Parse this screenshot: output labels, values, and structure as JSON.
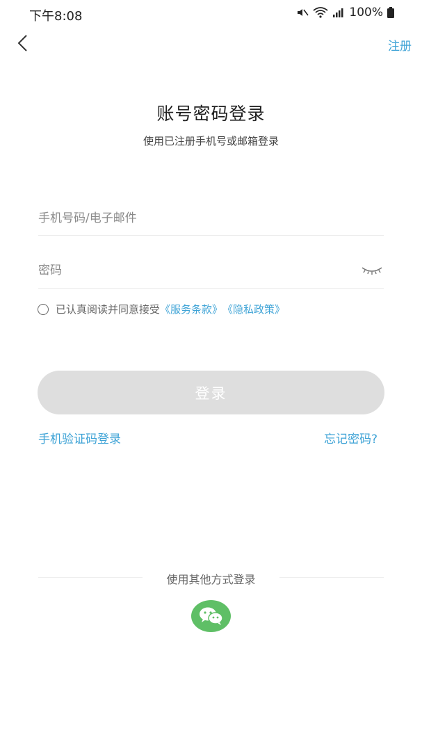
{
  "status_bar": {
    "time": "下午8:08",
    "battery": "100%",
    "icons": [
      "mute-icon",
      "wifi-icon",
      "signal-icon",
      "battery-icon"
    ]
  },
  "nav": {
    "back_icon": "chevron-left-icon",
    "register_label": "注册"
  },
  "header": {
    "title": "账号密码登录",
    "subtitle": "使用已注册手机号或邮箱登录"
  },
  "form": {
    "phone_placeholder": "手机号码/电子邮件",
    "phone_value": "",
    "password_placeholder": "密码",
    "password_value": "",
    "eye_icon": "eye-closed-icon"
  },
  "agreement": {
    "text": "已认真阅读并同意接受",
    "terms_link": "《服务条款》",
    "privacy_link": "《隐私政策》",
    "checked": false
  },
  "login_button": "登录",
  "links": {
    "sms_login": "手机验证码登录",
    "forgot_password": "忘记密码?"
  },
  "other_login": {
    "label": "使用其他方式登录",
    "wechat_icon": "wechat-icon"
  },
  "colors": {
    "accent": "#3ea3d6",
    "button_disabled": "#dedede",
    "wechat_green": "#5fbf66"
  }
}
